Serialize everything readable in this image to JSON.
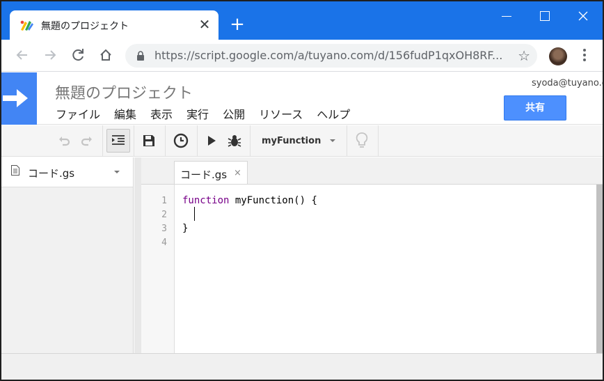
{
  "browser": {
    "tab_title": "無題のプロジェクト",
    "tab_close": "✕",
    "new_tab": "+",
    "url": "https://script.google.com/a/tuyano.com/d/156fudP1qxOH8RF..."
  },
  "app": {
    "project_title": "無題のプロジェクト",
    "user_email": "syoda@tuyano.c",
    "share_label": "共有",
    "menu": [
      "ファイル",
      "編集",
      "表示",
      "実行",
      "公開",
      "リソース",
      "ヘルプ"
    ],
    "brand_color": "#4285f4"
  },
  "toolbar": {
    "function_select": "myFunction"
  },
  "sidebar": {
    "files": [
      {
        "name": "コード.gs"
      }
    ]
  },
  "editor": {
    "tab_label": "コード.gs",
    "tab_close": "×",
    "line_numbers": [
      "1",
      "2",
      "3",
      "4"
    ],
    "keyword": "function",
    "line1_rest": " myFunction() {",
    "line3": "}"
  }
}
